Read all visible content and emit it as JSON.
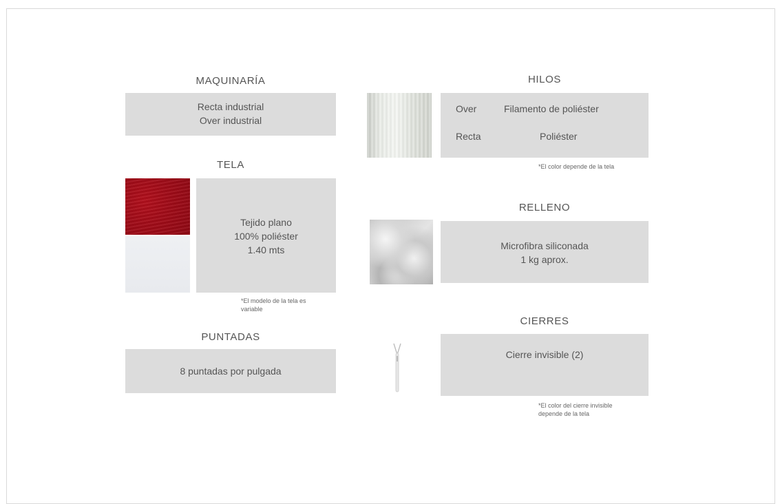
{
  "maquinaria": {
    "heading": "MAQUINARÍA",
    "line1": "Recta industrial",
    "line2": "Over industrial"
  },
  "tela": {
    "heading": "TELA",
    "line1": "Tejido plano",
    "line2": "100% poliéster",
    "line3": "1.40 mts",
    "note_line1": "*El modelo de la tela es",
    "note_line2": "variable",
    "swatch_colors": [
      "#a10c18",
      "#eceef1"
    ]
  },
  "puntadas": {
    "heading": "PUNTADAS",
    "text": "8 puntadas por pulgada"
  },
  "hilos": {
    "heading": "HILOS",
    "rows": [
      {
        "label": "Over",
        "value": "Filamento de poliéster"
      },
      {
        "label": "Recta",
        "value": "Poliéster"
      }
    ],
    "note": "*El color depende de la tela"
  },
  "relleno": {
    "heading": "RELLENO",
    "line1": "Microfibra siliconada",
    "line2": "1 kg aprox."
  },
  "cierres": {
    "heading": "CIERRES",
    "text": "Cierre invisible (2)",
    "note_line1": "*El color del cierre invisible",
    "note_line2": "depende de la tela"
  }
}
